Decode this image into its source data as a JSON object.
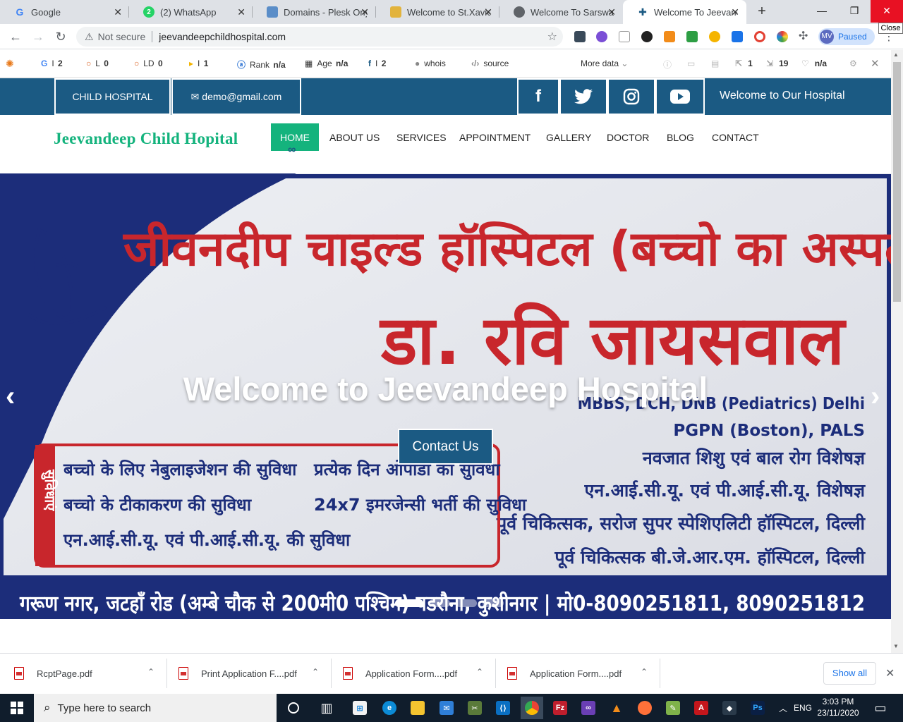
{
  "browser": {
    "tabs": [
      {
        "title": "Google",
        "icon": "google-icon"
      },
      {
        "title": "(2) WhatsApp",
        "icon": "whatsapp-icon",
        "badge": "2"
      },
      {
        "title": "Domains - Plesk Onyx",
        "icon": "plesk-icon"
      },
      {
        "title": "Welcome to St.Xavier",
        "icon": "school-icon"
      },
      {
        "title": "Welcome To Sarswati",
        "icon": "globe-icon"
      },
      {
        "title": "Welcome To Jeevandeep",
        "icon": "hospital-icon",
        "active": true
      }
    ],
    "new_tab": "+",
    "window": {
      "minimize": "—",
      "restore": "❐",
      "close": "✕",
      "close_tooltip": "Close"
    },
    "address": {
      "security": "Not secure",
      "url": "jeevandeepchildhospital.com"
    },
    "profile": {
      "initials": "MV",
      "status": "Paused"
    }
  },
  "seo_toolbar": {
    "items": [
      {
        "icon": "seoquake-icon",
        "label": "",
        "value": ""
      },
      {
        "icon": "google-icon",
        "label": "G",
        "value": "2"
      },
      {
        "icon": "circle-icon",
        "label": "L",
        "value": "0"
      },
      {
        "icon": "circle-icon",
        "label": "LD",
        "value": "0"
      },
      {
        "icon": "bing-icon",
        "label": "I",
        "value": "1"
      },
      {
        "icon": "rank-icon",
        "label": "Rank",
        "value": "n/a"
      },
      {
        "icon": "calendar-icon",
        "label": "Age",
        "value": "n/a"
      },
      {
        "icon": "facebook-icon",
        "label": "",
        "value": "2"
      },
      {
        "icon": "person-icon",
        "label": "whois",
        "value": ""
      },
      {
        "icon": "code-icon",
        "label": "source",
        "value": ""
      }
    ],
    "more": "More data",
    "right": [
      {
        "icon": "external-links-icon",
        "value": "1"
      },
      {
        "icon": "internal-links-icon",
        "value": "19"
      },
      {
        "icon": "heart-icon",
        "value": "n/a"
      }
    ]
  },
  "site": {
    "topbar": {
      "label": "CHILD HOSPITAL",
      "email": "demo@gmail.com",
      "social": [
        "facebook-icon",
        "twitter-icon",
        "instagram-icon",
        "youtube-icon"
      ],
      "welcome": "Welcome to Our Hospital"
    },
    "brand": "Jeevandeep Child Hopital",
    "menu": [
      "HOME",
      "ABOUT US",
      "SERVICES",
      "APPOINTMENT",
      "GALLERY",
      "DOCTOR",
      "BLOG",
      "CONTACT"
    ],
    "active_menu": "HOME",
    "hero": {
      "title": "Welcome to Jeevandeep Hospital",
      "button": "Contact Us",
      "prev": "‹",
      "next": "›",
      "slides": 4,
      "active_slide": 1,
      "banner": {
        "heading": "जीवनदीप चाइल्ड हॉस्पिटल (बच्चो का अस्पताल)",
        "doctor": "डा. रवि जायसवाल",
        "qualifications": [
          "MBBS, DCH, DNB (Pediatrics) Delhi",
          "PGPN (Boston), PALS"
        ],
        "specialties": [
          "नवजात शिशु एवं बाल रोग विशेषज्ञ",
          "एन.आई.सी.यू. एवं पी.आई.सी.यू. विशेषज्ञ",
          "पूर्व चिकित्सक, सरोज सुपर स्पेशिएलिटी हॉस्पिटल, दिल्ली",
          "पूर्व चिकित्सक बी.जे.आर.एम. हॉस्पिटल, दिल्ली"
        ],
        "facilities_label": "सुविधाएं",
        "facilities": [
          "बच्चो के लिए नेबुलाइजेशन की सुविधा",
          "बच्चो के टीकाकरण की सुविधा",
          "एन.आई.सी.यू. एवं पी.आई.सी.यू. की सुविधा",
          "प्रत्येक दिन ओपीडी की सुविधा",
          "24x7 इमरजेन्सी भर्ती की सुविधा"
        ],
        "footer": "गरूण नगर, जटहाँ रोड (अम्बे चौक से 200मी0 पश्चिम) पडरौना, कुशीनगर | मो0-8090251811, 8090251812"
      }
    }
  },
  "downloads": {
    "files": [
      "RcptPage.pdf",
      "Print Application F....pdf",
      "Application Form....pdf",
      "Application Form....pdf"
    ],
    "show_all": "Show all"
  },
  "taskbar": {
    "search_placeholder": "Type here to search",
    "lang": "ENG",
    "time": "3:03 PM",
    "date": "23/11/2020"
  },
  "colors": {
    "primary": "#1b5a83",
    "accent": "#14b37d",
    "banner_red": "#c8262c"
  }
}
